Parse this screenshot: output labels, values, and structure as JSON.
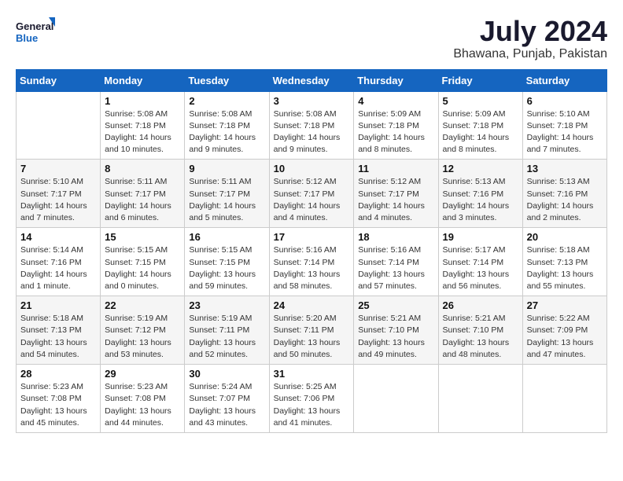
{
  "header": {
    "logo_line1": "General",
    "logo_line2": "Blue",
    "month": "July 2024",
    "location": "Bhawana, Punjab, Pakistan"
  },
  "weekdays": [
    "Sunday",
    "Monday",
    "Tuesday",
    "Wednesday",
    "Thursday",
    "Friday",
    "Saturday"
  ],
  "weeks": [
    [
      {
        "day": "",
        "info": ""
      },
      {
        "day": "1",
        "info": "Sunrise: 5:08 AM\nSunset: 7:18 PM\nDaylight: 14 hours\nand 10 minutes."
      },
      {
        "day": "2",
        "info": "Sunrise: 5:08 AM\nSunset: 7:18 PM\nDaylight: 14 hours\nand 9 minutes."
      },
      {
        "day": "3",
        "info": "Sunrise: 5:08 AM\nSunset: 7:18 PM\nDaylight: 14 hours\nand 9 minutes."
      },
      {
        "day": "4",
        "info": "Sunrise: 5:09 AM\nSunset: 7:18 PM\nDaylight: 14 hours\nand 8 minutes."
      },
      {
        "day": "5",
        "info": "Sunrise: 5:09 AM\nSunset: 7:18 PM\nDaylight: 14 hours\nand 8 minutes."
      },
      {
        "day": "6",
        "info": "Sunrise: 5:10 AM\nSunset: 7:18 PM\nDaylight: 14 hours\nand 7 minutes."
      }
    ],
    [
      {
        "day": "7",
        "info": "Sunrise: 5:10 AM\nSunset: 7:17 PM\nDaylight: 14 hours\nand 7 minutes."
      },
      {
        "day": "8",
        "info": "Sunrise: 5:11 AM\nSunset: 7:17 PM\nDaylight: 14 hours\nand 6 minutes."
      },
      {
        "day": "9",
        "info": "Sunrise: 5:11 AM\nSunset: 7:17 PM\nDaylight: 14 hours\nand 5 minutes."
      },
      {
        "day": "10",
        "info": "Sunrise: 5:12 AM\nSunset: 7:17 PM\nDaylight: 14 hours\nand 4 minutes."
      },
      {
        "day": "11",
        "info": "Sunrise: 5:12 AM\nSunset: 7:17 PM\nDaylight: 14 hours\nand 4 minutes."
      },
      {
        "day": "12",
        "info": "Sunrise: 5:13 AM\nSunset: 7:16 PM\nDaylight: 14 hours\nand 3 minutes."
      },
      {
        "day": "13",
        "info": "Sunrise: 5:13 AM\nSunset: 7:16 PM\nDaylight: 14 hours\nand 2 minutes."
      }
    ],
    [
      {
        "day": "14",
        "info": "Sunrise: 5:14 AM\nSunset: 7:16 PM\nDaylight: 14 hours\nand 1 minute."
      },
      {
        "day": "15",
        "info": "Sunrise: 5:15 AM\nSunset: 7:15 PM\nDaylight: 14 hours\nand 0 minutes."
      },
      {
        "day": "16",
        "info": "Sunrise: 5:15 AM\nSunset: 7:15 PM\nDaylight: 13 hours\nand 59 minutes."
      },
      {
        "day": "17",
        "info": "Sunrise: 5:16 AM\nSunset: 7:14 PM\nDaylight: 13 hours\nand 58 minutes."
      },
      {
        "day": "18",
        "info": "Sunrise: 5:16 AM\nSunset: 7:14 PM\nDaylight: 13 hours\nand 57 minutes."
      },
      {
        "day": "19",
        "info": "Sunrise: 5:17 AM\nSunset: 7:14 PM\nDaylight: 13 hours\nand 56 minutes."
      },
      {
        "day": "20",
        "info": "Sunrise: 5:18 AM\nSunset: 7:13 PM\nDaylight: 13 hours\nand 55 minutes."
      }
    ],
    [
      {
        "day": "21",
        "info": "Sunrise: 5:18 AM\nSunset: 7:13 PM\nDaylight: 13 hours\nand 54 minutes."
      },
      {
        "day": "22",
        "info": "Sunrise: 5:19 AM\nSunset: 7:12 PM\nDaylight: 13 hours\nand 53 minutes."
      },
      {
        "day": "23",
        "info": "Sunrise: 5:19 AM\nSunset: 7:11 PM\nDaylight: 13 hours\nand 52 minutes."
      },
      {
        "day": "24",
        "info": "Sunrise: 5:20 AM\nSunset: 7:11 PM\nDaylight: 13 hours\nand 50 minutes."
      },
      {
        "day": "25",
        "info": "Sunrise: 5:21 AM\nSunset: 7:10 PM\nDaylight: 13 hours\nand 49 minutes."
      },
      {
        "day": "26",
        "info": "Sunrise: 5:21 AM\nSunset: 7:10 PM\nDaylight: 13 hours\nand 48 minutes."
      },
      {
        "day": "27",
        "info": "Sunrise: 5:22 AM\nSunset: 7:09 PM\nDaylight: 13 hours\nand 47 minutes."
      }
    ],
    [
      {
        "day": "28",
        "info": "Sunrise: 5:23 AM\nSunset: 7:08 PM\nDaylight: 13 hours\nand 45 minutes."
      },
      {
        "day": "29",
        "info": "Sunrise: 5:23 AM\nSunset: 7:08 PM\nDaylight: 13 hours\nand 44 minutes."
      },
      {
        "day": "30",
        "info": "Sunrise: 5:24 AM\nSunset: 7:07 PM\nDaylight: 13 hours\nand 43 minutes."
      },
      {
        "day": "31",
        "info": "Sunrise: 5:25 AM\nSunset: 7:06 PM\nDaylight: 13 hours\nand 41 minutes."
      },
      {
        "day": "",
        "info": ""
      },
      {
        "day": "",
        "info": ""
      },
      {
        "day": "",
        "info": ""
      }
    ]
  ]
}
